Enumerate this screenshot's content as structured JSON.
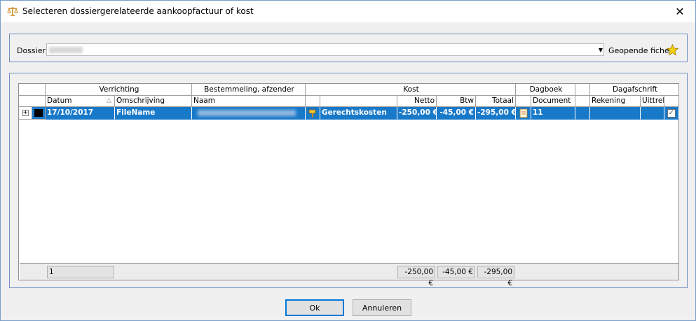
{
  "window": {
    "title": "Selecteren dossiergerelateerde aankoopfactuur of kost"
  },
  "dossier": {
    "label": "Dossier",
    "value": "",
    "geopende_label": "Geopende fiche"
  },
  "grid": {
    "group_headers": {
      "verrichting": "Verrichting",
      "bestemmeling": "Bestemmeling, afzender",
      "kost": "Kost",
      "dagboek": "Dagboek",
      "dagafschrift": "Dagafschrift"
    },
    "columns": {
      "datum": "Datum",
      "omschrijving": "Omschrijving",
      "naam": "Naam",
      "netto": "Netto",
      "btw": "Btw",
      "totaal": "Totaal",
      "document": "Document",
      "rekening": "Rekening",
      "uittreksel": "Uittrek"
    },
    "rows": [
      {
        "expand": "+",
        "datum": "17/10/2017",
        "omschrijving": "FileName",
        "naam": "",
        "kost": "Gerechtskosten",
        "netto": "-250,00 €",
        "btw": "-45,00 €",
        "totaal": "-295,00 €",
        "document": "11",
        "rekening": "",
        "uittreksel": "",
        "checked": true
      }
    ],
    "footer": {
      "count": "1",
      "netto": "-250,00 €",
      "btw": "-45,00 €",
      "totaal": "-295,00 €"
    }
  },
  "buttons": {
    "ok": "Ok",
    "cancel": "Annuleren"
  },
  "colors": {
    "selection": "#1979c9",
    "panel_border": "#6b8fbf",
    "client_bg": "#f0f0f0"
  }
}
